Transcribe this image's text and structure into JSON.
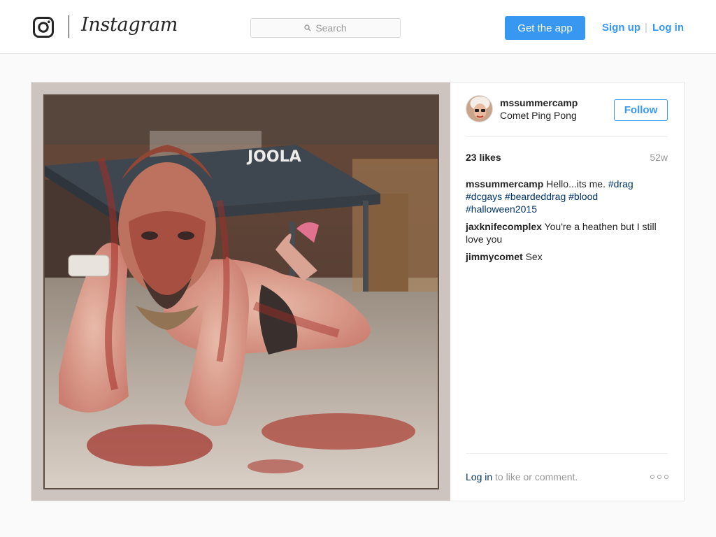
{
  "header": {
    "brand": "Instagram",
    "search_placeholder": "Search",
    "get_app": "Get the app",
    "sign_up": "Sign up",
    "separator": "|",
    "log_in": "Log in"
  },
  "post": {
    "username": "mssummercamp",
    "location": "Comet Ping Pong",
    "follow": "Follow",
    "likes": "23 likes",
    "age": "52w",
    "photo_text": "JOOLA",
    "caption": {
      "user": "mssummercamp",
      "text": "Hello...its me.",
      "tags": [
        "#drag",
        "#dcgays",
        "#beardeddrag",
        "#blood",
        "#halloween2015"
      ]
    },
    "comments": [
      {
        "user": "jaxknifecomplex",
        "text": "You're a heathen but I still love you"
      },
      {
        "user": "jimmycomet",
        "text": "Sex"
      }
    ],
    "footer": {
      "login": "Log in",
      "rest": "to like or comment."
    }
  }
}
